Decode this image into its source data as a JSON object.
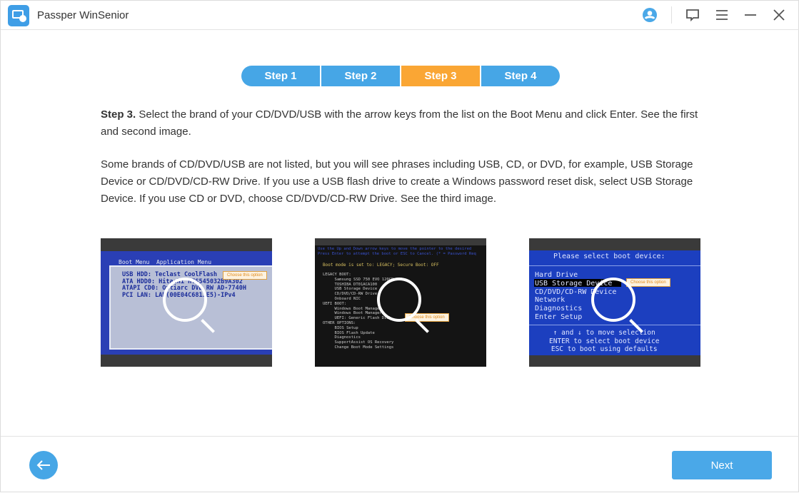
{
  "app": {
    "title": "Passper WinSenior"
  },
  "titlebar": {
    "icons": [
      "user-icon",
      "feedback-icon",
      "menu-icon",
      "minimize-icon",
      "close-icon"
    ]
  },
  "steps": [
    {
      "label": "Step 1"
    },
    {
      "label": "Step 2"
    },
    {
      "label": "Step 3",
      "active": true
    },
    {
      "label": "Step 4"
    }
  ],
  "colors": {
    "accent": "#46a6e6",
    "active_step": "#faa634"
  },
  "content": {
    "p1_bold": "Step 3.",
    "p1": " Select the brand of your CD/DVD/USB with the arrow keys from the list on the Boot Menu and click Enter. See the first and second image.",
    "p2": "Some brands of CD/DVD/USB are not listed, but you will see phrases including USB, CD, or DVD, for example, USB Storage Device or CD/DVD/CD-RW Drive. If you use a USB flash drive to create a Windows password reset disk, select USB Storage Device. If you use CD or DVD, choose CD/DVD/CD-RW Drive. See the third image."
  },
  "images": [
    {
      "tabs": "Boot Menu  Application Menu",
      "lines": "USB HDD: Teclast CoolFlash\nATA HDD0: Hitachi HTS545032B9A302\nATAPI CD0: Optiarc DVD RW AD-7740H\nPCI LAN: LAN(00E04C6813E5)-IPv4",
      "tip": "Choose this option"
    },
    {
      "header": "Use the Up and Down arrow keys to move the pointer to the desired\nPress Enter to attempt the boot or ESC to Cancel. (* = Password Req",
      "mode": "Boot mode is set to: LEGACY; Secure Boot: OFF",
      "lines": "LEGACY BOOT:\n     Samsung SSD 750 EVO 120GB\n     TOSHIBA DT01ACA100\n     USB Storage Device\n     CD/DVD/CD-RW Drive\n     Onboard NIC\nUEFI BOOT:\n     Windows Boot Manager\n     Windows Boot Manager\n     UEFI: Generic Flash Disk\nOTHER OPTIONS:\n     BIOS Setup\n     BIOS Flash Update\n     Diagnostics\n     SupportAssist OS Recovery\n     Change Boot Mode Settings",
      "tip": "Choose this option"
    },
    {
      "header": "Please select boot device:",
      "lines": "Hard Drive\nUSB Storage Device\nCD/DVD/CD-RW Device\nNetwork\nDiagnostics\nEnter Setup",
      "footer": "↑ and ↓ to move selection\nENTER to select boot device\nESC to boot using defaults",
      "tip": "Choose this option"
    }
  ],
  "footer": {
    "back_icon": "arrow-left-icon",
    "next_label": "Next"
  }
}
